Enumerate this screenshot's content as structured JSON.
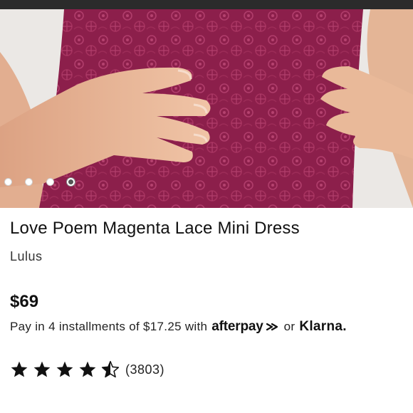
{
  "product": {
    "title": "Love Poem Magenta Lace Mini Dress",
    "brand": "Lulus",
    "price": "$69"
  },
  "payment": {
    "prefix": "Pay in 4 installments of $17.25 with",
    "afterpay": "afterpay",
    "or": "or",
    "klarna": "Klarna."
  },
  "gallery": {
    "image_count": 4,
    "active_index": 3
  },
  "rating": {
    "stars": 4.5,
    "max": 5,
    "count": "(3803)"
  },
  "colors": {
    "dress": "#8a1f4a",
    "skin": "#e7b595",
    "star": "#111111"
  }
}
